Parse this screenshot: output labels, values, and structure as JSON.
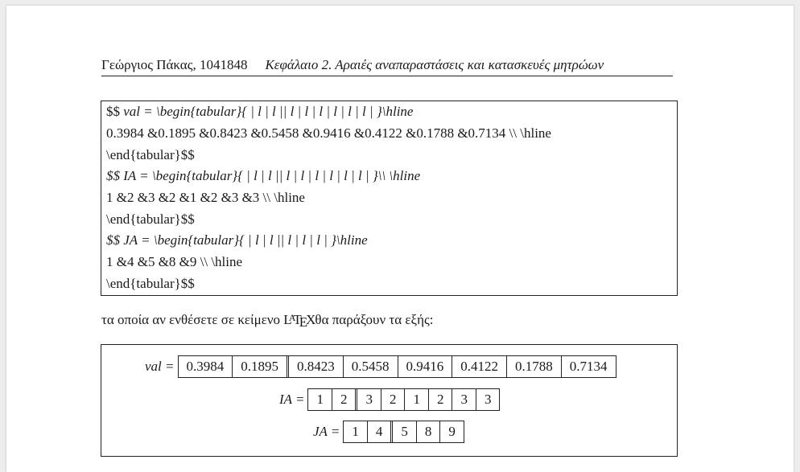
{
  "header": {
    "author": "Γεώργιος Πάκας, 1041848",
    "chapter": "Κεφάλαιο 2.  Αραιές αναπαραστάσεις και κατασκευές μητρώων"
  },
  "code": {
    "val_begin_a": "$$ ",
    "val_begin_b": "val = \\begin{tabular}{ | l | l || l | l | l | l | l | l | }\\hline",
    "val_row": "0.3984  &0.1895  &0.8423  &0.5458  &0.9416  &0.4122  &0.1788  &0.7134 \\\\ \\hline",
    "val_end": "\\end{tabular}$$",
    "ia_begin": "$$ IA = \\begin{tabular}{ | l |  l || l | l | l | l | l | l | }\\\\ \\hline",
    "ia_row": "1  &2  &3  &2  &1  &2  &3  &3 \\\\ \\hline",
    "ia_end": "\\end{tabular}$$",
    "ja_begin": "$$ JA = \\begin{tabular}{ | l | l || l | l | l | }\\hline",
    "ja_row": "1  &4  &5  &8  &9 \\\\ \\hline",
    "ja_end": "\\end{tabular}$$"
  },
  "paragraph": {
    "before": "τα οποία αν ενθέσετε σε κείμενο ",
    "latex_logo": "LATEX",
    "after": "θα παράξουν τα εξής:"
  },
  "rendered": {
    "val": {
      "label": "val =",
      "values": [
        "0.3984",
        "0.1895",
        "0.8423",
        "0.5458",
        "0.9416",
        "0.4122",
        "0.1788",
        "0.7134"
      ]
    },
    "ia": {
      "label": "IA =",
      "values": [
        "1",
        "2",
        "3",
        "2",
        "1",
        "2",
        "3",
        "3"
      ]
    },
    "ja": {
      "label": "JA =",
      "values": [
        "1",
        "4",
        "5",
        "8",
        "9"
      ]
    }
  }
}
